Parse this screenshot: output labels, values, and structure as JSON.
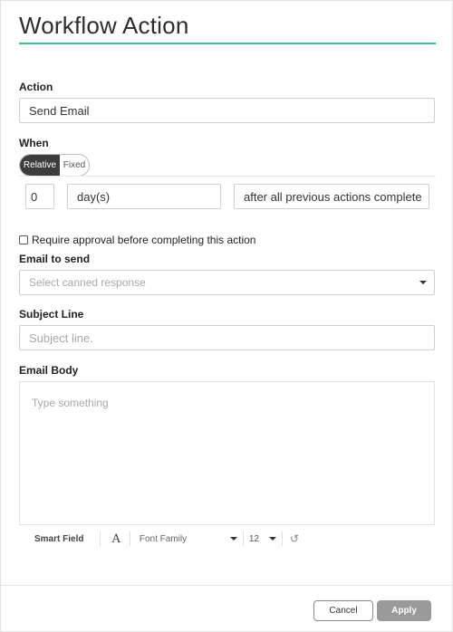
{
  "title": "Workflow Action",
  "action": {
    "label": "Action",
    "value": "Send Email"
  },
  "when": {
    "label": "When",
    "toggle_on": "Relative",
    "toggle_off": "Fixed",
    "offset_value": "0",
    "unit_value": "day(s)",
    "trigger_value": "after all previous actions complete"
  },
  "approval": {
    "label": "Require approval before completing this action",
    "checked": false
  },
  "email_to_send": {
    "label": "Email to send",
    "placeholder": "Select canned response"
  },
  "subject": {
    "label": "Subject Line",
    "placeholder": "Subject line."
  },
  "body": {
    "label": "Email Body",
    "placeholder": "Type something"
  },
  "toolbar": {
    "smart_field": "Smart Field",
    "font_icon_glyph": "A",
    "font_family": "Font Family",
    "font_size": "12",
    "undo_glyph": "↺"
  },
  "buttons": {
    "cancel": "Cancel",
    "apply": "Apply"
  },
  "colors": {
    "accent": "#3fbf9a",
    "toggle_active": "#3d3d3d",
    "apply_button": "#9a9a9a"
  }
}
